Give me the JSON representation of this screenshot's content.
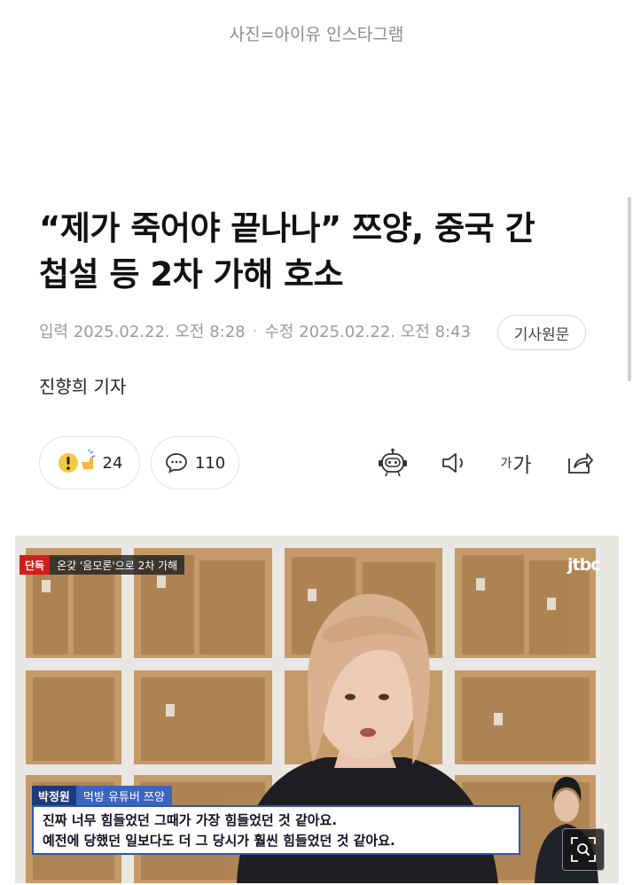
{
  "photo_caption": "사진=아이유 인스타그램",
  "article": {
    "headline_line1": "“제가 죽어야 끝나나” 쯔양, 중국 간",
    "headline_line2": "첩설 등 2차 가해 호소",
    "input_label": "입력",
    "input_time": "2025.02.22. 오전 8:28",
    "modified_label": "수정",
    "modified_time": "2025.02.22. 오전 8:43",
    "original_button": "기사원문",
    "reporter": "진향희 기자"
  },
  "actions": {
    "reaction_count": "24",
    "comment_count": "110",
    "font_size_small": "가",
    "font_size_large": "가"
  },
  "video": {
    "tag_exclusive": "단독",
    "tag_topic": "온갖 '음모론'으로 2차 가해",
    "broadcaster": "jtbc",
    "speaker_name": "박정원",
    "speaker_desc": "먹방 유튜버 쯔양",
    "subtitle_line1": "진짜 너무 힘들었던 그때가 가장 힘들었던 것 같아요.",
    "subtitle_line2": "예전에 당했던 일보다도 더 그 당시가 훨씬 힘들었던 것 같아요."
  },
  "colors": {
    "tag_red": "#d21d1d",
    "caption_box_border": "#2d56b3",
    "name_tag": "#1b3a7a"
  }
}
